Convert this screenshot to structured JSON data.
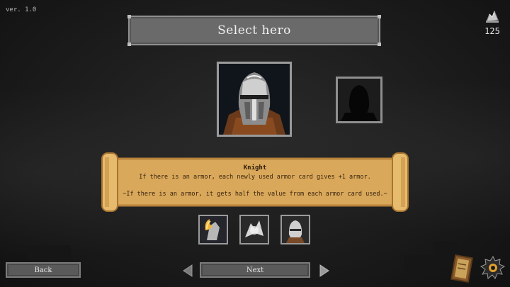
{
  "version": "ver. 1.0",
  "title": "Select hero",
  "currency": {
    "icon": "silver-coins-icon",
    "value": "125"
  },
  "hero": {
    "portrait": "knight-helmet-portrait",
    "name": "Knight",
    "description": "If there is an armor, each newly used armor card gives +1 armor.",
    "passive": "~If there is an armor, it gets half the value from each armor card used.~"
  },
  "locked_hero": {
    "icon": "locked-hero-silhouette"
  },
  "cards": [
    {
      "icon": "flaming-gauntlet-card-icon"
    },
    {
      "icon": "armor-burst-card-icon"
    },
    {
      "icon": "knight-helmet-card-icon"
    }
  ],
  "buttons": {
    "back": "Back",
    "next": "Next"
  },
  "colors": {
    "parchment": "#d9a85a",
    "panel": "#6a6a6a",
    "frame": "#9a9a9a"
  }
}
